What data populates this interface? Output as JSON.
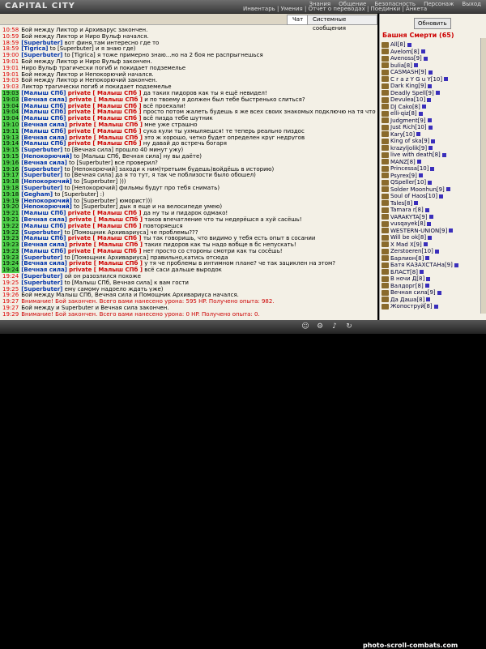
{
  "app": {
    "logo": "CAPITAL CITY"
  },
  "menu": {
    "items": [
      "Знания",
      "Общение",
      "Безопасность",
      "Персонаж",
      "Выход"
    ],
    "submenu": "Инвентарь | Умения | Отчет о переводах | Поединки | Анкета"
  },
  "chat": {
    "tabs": [
      "Чат",
      "Системные сообщения"
    ],
    "lines": [
      {
        "t": "10:58",
        "g": false,
        "nick": "",
        "text": "Бой между Ликтор и Архиварус закончен."
      },
      {
        "t": "10:59",
        "g": false,
        "nick": "",
        "text": "Бой между Ликтор и Ниро Вульф начался."
      },
      {
        "t": "18:59",
        "g": false,
        "nick": "[Superbuter]",
        "text": "вот финя,там интересно где то"
      },
      {
        "t": "18:59",
        "g": false,
        "nick": "[Tigrica]",
        "text": "to [Superbuter] и я знаю где)"
      },
      {
        "t": "19:00",
        "g": false,
        "nick": "[Superbuter]",
        "text": "to [Tigrica] я тоже примерно знаю...но на 2 боя не распрыгнешься"
      },
      {
        "t": "19:01",
        "g": false,
        "nick": "",
        "text": "Бой между Ликтор и Ниро Вульф закончен."
      },
      {
        "t": "19:01",
        "g": false,
        "nick": "",
        "text": "Ниро Вульф трагически погиб и покидает подземелье"
      },
      {
        "t": "19:01",
        "g": false,
        "nick": "",
        "text": "Бой между Ликтор и Непокорючий начался."
      },
      {
        "t": "19:03",
        "g": false,
        "nick": "",
        "text": "Бой между Ликтор и Непокорючий закончен."
      },
      {
        "t": "19:03",
        "g": false,
        "nick": "",
        "text": "Ликтор трагически погиб и покидает подземелье"
      },
      {
        "t": "19:03",
        "g": true,
        "nick": "[Малыш СПб]",
        "priv": "private [ Малыш СПб ]",
        "text": "да таких пидоров как ты я ещё невидел!"
      },
      {
        "t": "19:03",
        "g": true,
        "nick": "[Вечная сила]",
        "priv": "private [ Малыш СПб ]",
        "text": "и по твоему я должен был тебе быстренько слиться?"
      },
      {
        "t": "19:04",
        "g": true,
        "nick": "[Малыш СПб]",
        "priv": "private [ Малыш СПб ]",
        "text": "всё проехали!"
      },
      {
        "t": "19:04",
        "g": true,
        "nick": "[Малыш СПб]",
        "priv": "private [ Малыш СПб ]",
        "text": "просто потом жалеть будешь я же всех своих знакомых подключю на тя чтоб истребили!"
      },
      {
        "t": "19:04",
        "g": true,
        "nick": "[Малыш СПб]",
        "priv": "private [ Малыш СПб ]",
        "text": "всё пизда тебе шутник"
      },
      {
        "t": "19:10",
        "g": true,
        "nick": "[Вечная сила]",
        "priv": "private [ Малыш СПб ]",
        "text": "мне уже страшно"
      },
      {
        "t": "19:11",
        "g": true,
        "nick": "[Малыш СПб]",
        "priv": "private [ Малыш СПб ]",
        "text": "сука кули ты ухмыляешся! те теперь реально пиздос"
      },
      {
        "t": "19:13",
        "g": true,
        "nick": "[Вечная сила]",
        "priv": "private [ Малыш СПб ]",
        "text": "это ж хорошо, четко будет определен круг недругов"
      },
      {
        "t": "19:14",
        "g": true,
        "nick": "[Малыш СПб]",
        "priv": "private [ Малыш СПб ]",
        "text": "ну давай до встречь богаря"
      },
      {
        "t": "19:15",
        "g": true,
        "nick": "[Superbuter]",
        "text": "to [Вечная сила] прошло 40 минут ужу)"
      },
      {
        "t": "19:15",
        "g": true,
        "nick": "[Непокорючий]",
        "text": "to [Малыш СПб, Вечная сила] ну вы даёте)"
      },
      {
        "t": "19:16",
        "g": true,
        "nick": "[Вечная сила]",
        "text": "to [Superbuter] все проверил?"
      },
      {
        "t": "19:16",
        "g": true,
        "nick": "[Superbuter]",
        "text": "to [Непокорючий] заходи к ним)третьим будешь)войдёшь в историю)"
      },
      {
        "t": "19:17",
        "g": true,
        "nick": "[Superbuter]",
        "text": "to [Вечная сила] да я то тут, я так че поблизости было обошел)"
      },
      {
        "t": "19:18",
        "g": true,
        "nick": "[Непокорючий]",
        "text": "to [Superbuter] )))"
      },
      {
        "t": "19:18",
        "g": true,
        "nick": "[Superbuter]",
        "text": "to [Непокорючий] фильмы будут про тебя снимать)"
      },
      {
        "t": "19:18",
        "g": true,
        "nick": "[Gegham]",
        "text": "to [Superbuter] :)"
      },
      {
        "t": "19:19",
        "g": true,
        "nick": "[Непокорючий]",
        "text": "to [Superbuter] юморист)))"
      },
      {
        "t": "19:20",
        "g": true,
        "nick": "[Непокорючий]",
        "text": "to [Superbuter] дык я еще и на велосипеде умею)"
      },
      {
        "t": "19:21",
        "g": true,
        "nick": "[Малыш СПб]",
        "priv": "private [ Малыш СПб ]",
        "text": "да ну ты и пидарок одмако!"
      },
      {
        "t": "19:21",
        "g": true,
        "nick": "[Вечная сила]",
        "priv": "private [ Малыш СПб ]",
        "text": "таков впечатление что ты недерёшся а хуй сасёшь!"
      },
      {
        "t": "19:22",
        "g": true,
        "nick": "[Малыш СПб]",
        "priv": "private [ Малыш СПб ]",
        "text": "повторяешся"
      },
      {
        "t": "19:22",
        "g": true,
        "nick": "[Superbuter]",
        "text": "to [Помощник Архивариуса] че проблемы???"
      },
      {
        "t": "19:23",
        "g": true,
        "nick": "[Малыш СПб]",
        "priv": "private [ Малыш СПб ]",
        "text": "ты так говоришь, что видимо у тебя есть опыт в сосании"
      },
      {
        "t": "19:23",
        "g": true,
        "nick": "[Вечная сила]",
        "priv": "private [ Малыш СПб ]",
        "text": "таких пидоров как ты надо вобще в бс непускать!"
      },
      {
        "t": "19:23",
        "g": true,
        "nick": "[Малыш СПб]",
        "priv": "private [ Малыш СПб ]",
        "text": "нет просто со стороны смотри как ты сосёшь!"
      },
      {
        "t": "19:23",
        "g": true,
        "nick": "[Superbuter]",
        "text": "to [Помощник Архивариуса] правильно,катись отсюда"
      },
      {
        "t": "19:24",
        "g": true,
        "nick": "[Вечная сила]",
        "priv": "private [ Малыш СПб ]",
        "text": "у тя че проблемы в интимном плане? че так зациклен на этом?"
      },
      {
        "t": "19:24",
        "g": true,
        "nick": "[Вечная сила]",
        "priv": "private [ Малыш СПб ]",
        "text": "всё саси дальше выродок"
      },
      {
        "t": "19:24",
        "g": false,
        "nick": "[Superbuter]",
        "text": "ой он разозлился похоже"
      },
      {
        "t": "19:25",
        "g": false,
        "nick": "[Superbuter]",
        "text": "to [Малыш СПб, Вечная сила] к вам гости"
      },
      {
        "t": "19:25",
        "g": false,
        "nick": "[Superbuter]",
        "text": "ему самому надоело ждать уже)"
      },
      {
        "t": "19:26",
        "g": false,
        "nick": "",
        "text": "Бой между Малыш СПб, Вечная сила и Помощник Архивариуса начался."
      },
      {
        "t": "19:27",
        "g": false,
        "red": true,
        "nick": "",
        "text": "Внимание! Бой закончен. Всего вами нанесено урона: 595 HP. Получено опыта: 982."
      },
      {
        "t": "19:27",
        "g": false,
        "nick": "",
        "text": "Бой между и Superbuter и Вечная сила закончен."
      },
      {
        "t": "19:29",
        "g": false,
        "red": true,
        "nick": "",
        "text": "Внимание! Бой закончен. Всего вами нанесено урона: 0 HP. Получено опыта: 0."
      }
    ]
  },
  "right": {
    "refresh": "Обновить",
    "room": "Башня Смерти (65)",
    "users": [
      "All[8]",
      "Avelom[8]",
      "Avenoss[9]",
      "bulia[8]",
      "CASMASH[9]",
      "C r a z Y G u Y[10]",
      "Dark King[9]",
      "Deadly Spell[9]",
      "Devulea[10]",
      "DJ Cako[8]",
      "elli-qiz[8]",
      "Judgment[9]",
      "Just Rich[10]",
      "Kary[10]",
      "King of ska[9]",
      "krazyljolik[9]",
      "live with death[8]",
      "MANZ[8]",
      "Princessa[10]",
      "Psyrex[9]",
      "QSpeller[10]",
      "Solder Moonhun[9]",
      "Soul of Haos[10]",
      "Tales[8]",
      "Tamara r[8]",
      "VARAKYTA[9]",
      "vusqayek[8]",
      "WESTERN-UNION[9]",
      "Will be ok[8]",
      "X Mad X[9]",
      "Zerstoeren[10]",
      "Барлион[8]",
      "Батя КАЗАХСТАНа[9]",
      "БЛАСТ[8]",
      "В ночи Д[8]",
      "Валдорг[8]",
      "Вечная сила[9]",
      "Да Даша[8]",
      "Жопоструй[8]"
    ]
  },
  "footer": {
    "watermark": "photo-scroll-combats.com"
  }
}
